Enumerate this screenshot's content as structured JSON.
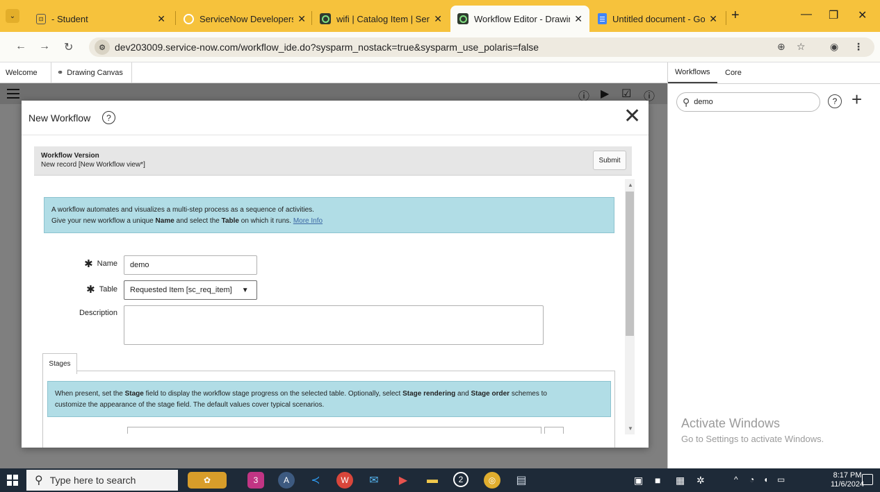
{
  "browser": {
    "tabs": [
      {
        "title": "- Student",
        "icon": "page-icon",
        "active": false
      },
      {
        "title": "ServiceNow Developers",
        "icon": "servicenow-ring-icon",
        "active": false
      },
      {
        "title": "wifi | Catalog Item | Servi",
        "icon": "servicenow-icon",
        "active": false
      },
      {
        "title": "Workflow Editor - Drawin",
        "icon": "servicenow-icon",
        "active": true
      },
      {
        "title": "Untitled document - Goo",
        "icon": "google-docs-icon",
        "active": false
      }
    ],
    "close_glyph": "✕",
    "new_tab_glyph": "+",
    "url": "dev203009.service-now.com/workflow_ide.do?sysparm_nostack=true&sysparm_use_polaris=false",
    "tab_strip_color": "#f6c23c"
  },
  "app": {
    "tabs": [
      {
        "label": "Welcome"
      },
      {
        "label": "Drawing Canvas"
      }
    ]
  },
  "right_panel": {
    "tabs": [
      {
        "label": "Workflows"
      },
      {
        "label": "Core"
      }
    ],
    "search_value": "demo",
    "help_glyph": "?",
    "add_glyph": "+"
  },
  "modal": {
    "title": "New Workflow",
    "help_glyph": "?",
    "close_glyph": "✕",
    "form_header": {
      "title": "Workflow Version",
      "subtitle": "New record [New Workflow view*]",
      "submit_label": "Submit"
    },
    "info": {
      "line1": "A workflow automates and visualizes a multi-step process as a sequence of activities.",
      "line2_a": "Give your new workflow a unique ",
      "line2_name": "Name",
      "line2_b": " and select the ",
      "line2_table": "Table",
      "line2_c": " on which it runs. ",
      "more_info": "More Info"
    },
    "fields": {
      "name_label": "Name",
      "name_value": "demo",
      "table_label": "Table",
      "table_value": "Requested Item [sc_req_item]",
      "description_label": "Description",
      "description_value": "",
      "required_glyph": "✱"
    },
    "stages": {
      "tab_label": "Stages",
      "info_a": "When present, set the ",
      "info_stage": "Stage",
      "info_b": " field to display the workflow stage progress on the selected table. Optionally, select ",
      "info_render": "Stage rendering",
      "info_c": " and ",
      "info_order": "Stage order",
      "info_d": " schemes to",
      "info_line2": "customize the appearance of the stage field. The default values cover typical scenarios."
    }
  },
  "watermark": {
    "line1": "Activate Windows",
    "line2": "Go to Settings to activate Windows."
  },
  "taskbar": {
    "search_placeholder": "Type here to search",
    "time": "8:17 PM",
    "date": "11/6/2024",
    "instagram_badge": "3",
    "whatsapp_badge": "2"
  }
}
